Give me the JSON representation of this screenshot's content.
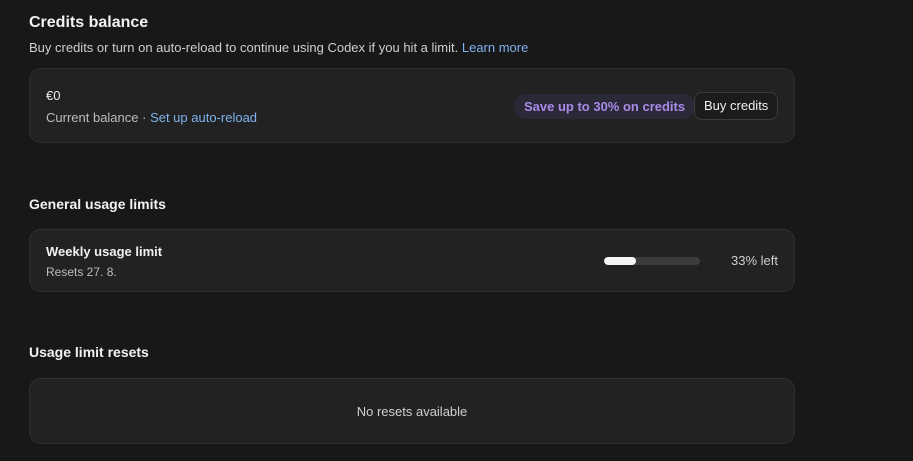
{
  "credits": {
    "title": "Credits balance",
    "description": "Buy credits or turn on auto-reload to continue using Codex if you hit a limit.",
    "learn_more": "Learn more",
    "balance": "€0",
    "balance_label": "Current balance",
    "separator": " · ",
    "auto_reload_link": "Set up auto-reload",
    "promo": "Save up to 30% on credits",
    "buy_button": "Buy credits",
    "accent_color": "#a98be8",
    "link_color": "#7fb2ee"
  },
  "usage": {
    "title": "General usage limits",
    "limit_name": "Weekly usage limit",
    "resets": "Resets 27. 8.",
    "percent_left_label": "33% left",
    "used_fraction": 0.33
  },
  "resets": {
    "title": "Usage limit resets",
    "empty_message": "No resets available"
  }
}
